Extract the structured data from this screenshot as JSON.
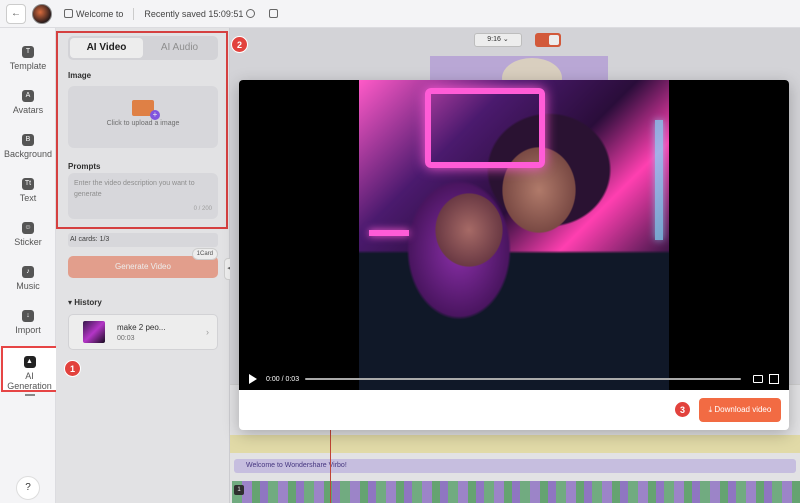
{
  "header": {
    "back_icon": "←",
    "project_name": "Welcome to",
    "save_status": "Recently saved 15:09:51"
  },
  "nav": {
    "items": [
      {
        "label": "Template",
        "icon": "T"
      },
      {
        "label": "Avatars",
        "icon": "A"
      },
      {
        "label": "Background",
        "icon": "B"
      },
      {
        "label": "Text",
        "icon": "Tt"
      },
      {
        "label": "Sticker",
        "icon": "☺"
      },
      {
        "label": "Music",
        "icon": "♪"
      },
      {
        "label": "Import",
        "icon": "↓"
      }
    ],
    "ai_generation": "AI Generation",
    "help_icon": "?"
  },
  "panel": {
    "tabs": [
      "AI Video",
      "AI Audio"
    ],
    "image_label": "Image",
    "upload_text": "Click to upload a image",
    "prompts_label": "Prompts",
    "prompt_placeholder": "Enter the video description you want to generate",
    "char_count": "0 / 200",
    "ai_cards": "AI cards: 1/3",
    "generate_button": "Generate Video",
    "card_badge": "1Card",
    "history_label": "History",
    "history_items": [
      {
        "name": "make 2 peo...",
        "duration": "00:03"
      }
    ]
  },
  "workspace": {
    "aspect_ratio": "9:16 ⌄",
    "timeline_text": "Welcome to Wondershare Virbo!",
    "track_badge": "1"
  },
  "player": {
    "time": "0:00 / 0:03",
    "progress": 0.0,
    "download_button": "Download video"
  },
  "callouts": [
    "1",
    "2",
    "3"
  ],
  "colors": {
    "accent": "#f26b43",
    "callout_red": "#e2423d"
  }
}
